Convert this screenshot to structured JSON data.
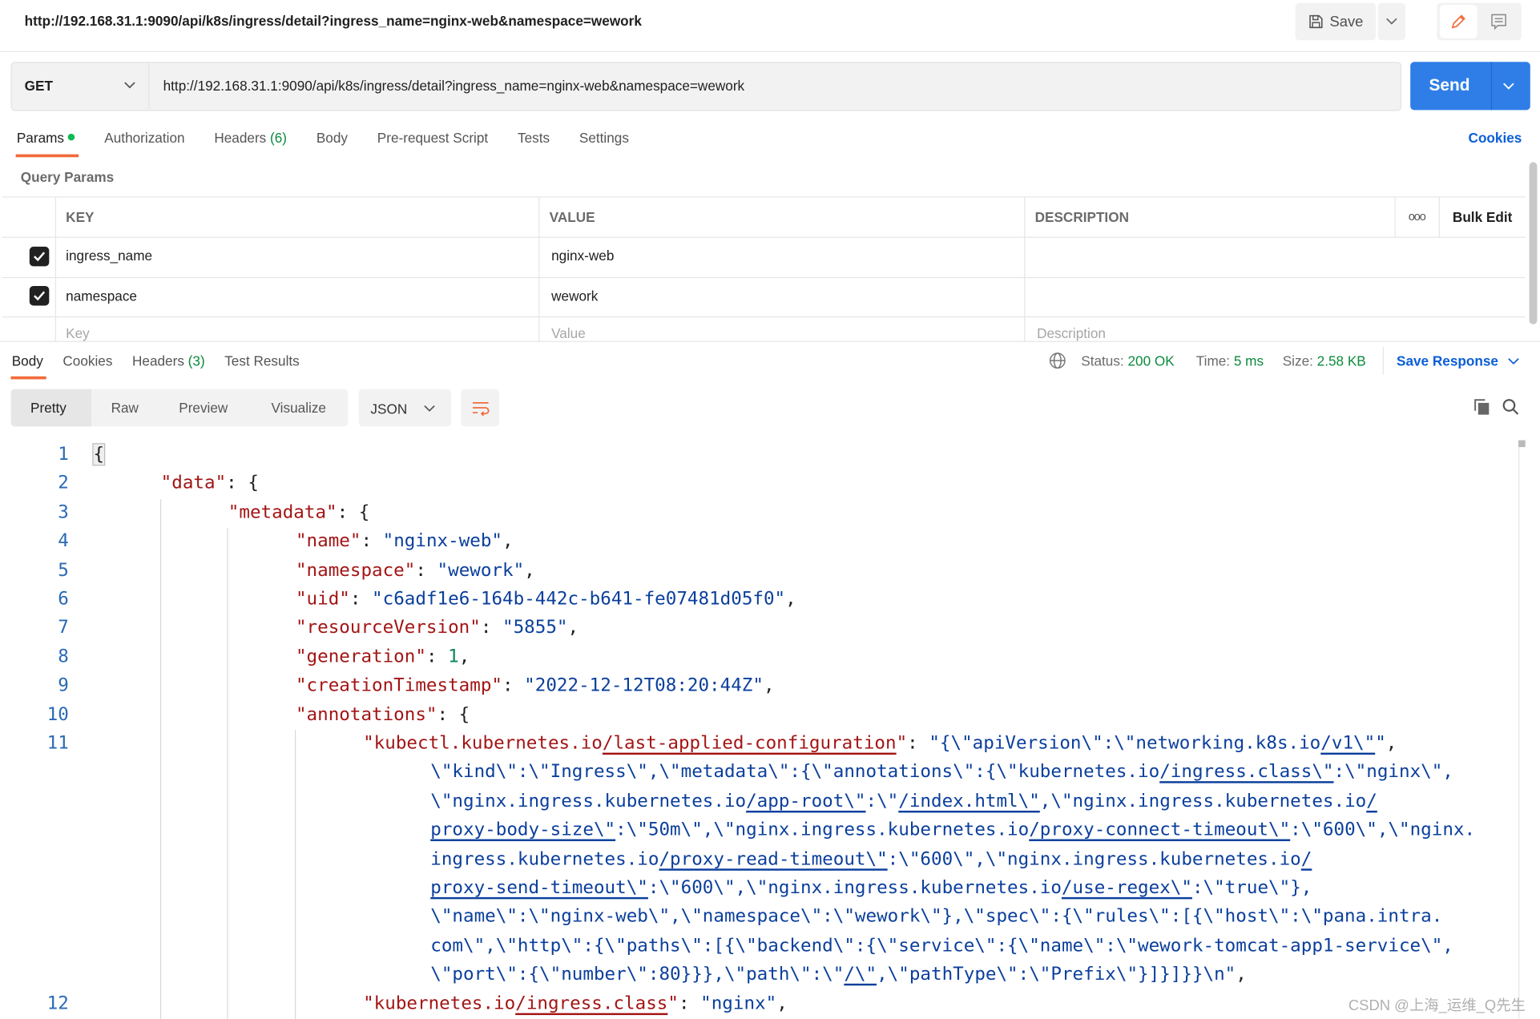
{
  "header": {
    "tab_title": "http://192.168.31.1:9090/api/k8s/ingress/detail?ingress_name=nginx-web&namespace=wework",
    "save_label": "Save"
  },
  "request": {
    "method": "GET",
    "url": "http://192.168.31.1:9090/api/k8s/ingress/detail?ingress_name=nginx-web&namespace=wework",
    "send_label": "Send",
    "tabs": [
      {
        "label": "Params",
        "active": true
      },
      {
        "label": "Authorization"
      },
      {
        "label": "Headers",
        "count": "(6)"
      },
      {
        "label": "Body"
      },
      {
        "label": "Pre-request Script"
      },
      {
        "label": "Tests"
      },
      {
        "label": "Settings"
      }
    ],
    "cookies_label": "Cookies"
  },
  "params": {
    "section_title": "Query Params",
    "columns": {
      "key": "KEY",
      "value": "VALUE",
      "description": "DESCRIPTION",
      "bulk_edit": "Bulk Edit"
    },
    "rows": [
      {
        "checked": true,
        "key": "ingress_name",
        "value": "nginx-web",
        "description": ""
      },
      {
        "checked": true,
        "key": "namespace",
        "value": "wework",
        "description": ""
      }
    ],
    "placeholders": {
      "key": "Key",
      "value": "Value",
      "description": "Description"
    }
  },
  "response": {
    "tabs": [
      {
        "label": "Body",
        "active": true
      },
      {
        "label": "Cookies"
      },
      {
        "label": "Headers",
        "count": "(3)"
      },
      {
        "label": "Test Results"
      }
    ],
    "status_label": "Status:",
    "status": "200 OK",
    "time_label": "Time:",
    "time": "5 ms",
    "size_label": "Size:",
    "size": "2.58 KB",
    "save_response_label": "Save Response",
    "formats": [
      "Pretty",
      "Raw",
      "Preview",
      "Visualize"
    ],
    "active_format": "Pretty",
    "language": "JSON"
  },
  "code_rows": [
    {
      "num": "1",
      "indent": 0,
      "tokens": [
        [
          "p",
          "{"
        ]
      ]
    },
    {
      "num": "2",
      "indent": 1,
      "tokens": [
        [
          "k",
          "\"data\""
        ],
        [
          "p",
          ": {"
        ]
      ]
    },
    {
      "num": "3",
      "indent": 2,
      "tokens": [
        [
          "k",
          "\"metadata\""
        ],
        [
          "p",
          ": {"
        ]
      ]
    },
    {
      "num": "4",
      "indent": 3,
      "tokens": [
        [
          "k",
          "\"name\""
        ],
        [
          "p",
          ": "
        ],
        [
          "s",
          "\"nginx-web\""
        ],
        [
          "p",
          ","
        ]
      ]
    },
    {
      "num": "5",
      "indent": 3,
      "tokens": [
        [
          "k",
          "\"namespace\""
        ],
        [
          "p",
          ": "
        ],
        [
          "s",
          "\"wework\""
        ],
        [
          "p",
          ","
        ]
      ]
    },
    {
      "num": "6",
      "indent": 3,
      "tokens": [
        [
          "k",
          "\"uid\""
        ],
        [
          "p",
          ": "
        ],
        [
          "s",
          "\"c6adf1e6-164b-442c-b641-fe07481d05f0\""
        ],
        [
          "p",
          ","
        ]
      ]
    },
    {
      "num": "7",
      "indent": 3,
      "tokens": [
        [
          "k",
          "\"resourceVersion\""
        ],
        [
          "p",
          ": "
        ],
        [
          "s",
          "\"5855\""
        ],
        [
          "p",
          ","
        ]
      ]
    },
    {
      "num": "8",
      "indent": 3,
      "tokens": [
        [
          "k",
          "\"generation\""
        ],
        [
          "p",
          ": "
        ],
        [
          "n",
          "1"
        ],
        [
          "p",
          ","
        ]
      ]
    },
    {
      "num": "9",
      "indent": 3,
      "tokens": [
        [
          "k",
          "\"creationTimestamp\""
        ],
        [
          "p",
          ": "
        ],
        [
          "s",
          "\"2022-12-12T08:20:44Z\""
        ],
        [
          "p",
          ","
        ]
      ]
    },
    {
      "num": "10",
      "indent": 3,
      "tokens": [
        [
          "k",
          "\"annotations\""
        ],
        [
          "p",
          ": {"
        ]
      ]
    },
    {
      "num": "11",
      "indent": 4,
      "tokens": [
        [
          "k",
          "\"kubectl.kubernetes.io"
        ],
        [
          "ku",
          "/last-applied-configuration"
        ],
        [
          "k",
          "\""
        ],
        [
          "p",
          ": "
        ],
        [
          "s",
          "\"{\\\"apiVersion\\\":\\\"networking.k8s.io"
        ],
        [
          "su",
          "/v1\\\""
        ],
        [
          "s",
          "\""
        ],
        [
          "p",
          ","
        ]
      ]
    },
    {
      "num": "",
      "indent": 5,
      "tokens": [
        [
          "s",
          "\\\"kind\\\":\\\"Ingress\\\",\\\"metadata\\\":{\\\"annotations\\\":{\\\"kubernetes.io"
        ],
        [
          "su",
          "/ingress.class\\\""
        ],
        [
          "s",
          ":\\\"nginx\\\","
        ]
      ]
    },
    {
      "num": "",
      "indent": 5,
      "tokens": [
        [
          "s",
          "\\\"nginx.ingress.kubernetes.io"
        ],
        [
          "su",
          "/app-root\\\""
        ],
        [
          "s",
          ":\\\""
        ],
        [
          "su",
          "/index.html\\\""
        ],
        [
          "s",
          ",\\\"nginx.ingress.kubernetes.io"
        ],
        [
          "su",
          "/"
        ]
      ]
    },
    {
      "num": "",
      "indent": 5,
      "tokens": [
        [
          "su",
          "proxy-body-size\\\""
        ],
        [
          "s",
          ":\\\"50m\\\",\\\"nginx.ingress.kubernetes.io"
        ],
        [
          "su",
          "/proxy-connect-timeout\\\""
        ],
        [
          "s",
          ":\\\"600\\\",\\\"nginx."
        ]
      ]
    },
    {
      "num": "",
      "indent": 5,
      "tokens": [
        [
          "s",
          "ingress.kubernetes.io"
        ],
        [
          "su",
          "/proxy-read-timeout\\\""
        ],
        [
          "s",
          ":\\\"600\\\",\\\"nginx.ingress.kubernetes.io"
        ],
        [
          "su",
          "/"
        ]
      ]
    },
    {
      "num": "",
      "indent": 5,
      "tokens": [
        [
          "su",
          "proxy-send-timeout\\\""
        ],
        [
          "s",
          ":\\\"600\\\",\\\"nginx.ingress.kubernetes.io"
        ],
        [
          "su",
          "/use-regex\\\""
        ],
        [
          "s",
          ":\\\"true\\\"},"
        ]
      ]
    },
    {
      "num": "",
      "indent": 5,
      "tokens": [
        [
          "s",
          "\\\"name\\\":\\\"nginx-web\\\",\\\"namespace\\\":\\\"wework\\\"},\\\"spec\\\":{\\\"rules\\\":[{\\\"host\\\":\\\"pana.intra."
        ]
      ]
    },
    {
      "num": "",
      "indent": 5,
      "tokens": [
        [
          "s",
          "com\\\",\\\"http\\\":{\\\"paths\\\":[{\\\"backend\\\":{\\\"service\\\":{\\\"name\\\":\\\"wework-tomcat-app1-service\\\","
        ]
      ]
    },
    {
      "num": "",
      "indent": 5,
      "tokens": [
        [
          "s",
          "\\\"port\\\":{\\\"number\\\":80}}},\\\"path\\\":\\\""
        ],
        [
          "su",
          "/\\\""
        ],
        [
          "s",
          ",\\\"pathType\\\":\\\"Prefix\\\"}]}]}}\\n\""
        ],
        [
          "p",
          ","
        ]
      ]
    },
    {
      "num": "12",
      "indent": 4,
      "tokens": [
        [
          "k",
          "\"kubernetes.io"
        ],
        [
          "ku",
          "/ingress.class"
        ],
        [
          "k",
          "\""
        ],
        [
          "p",
          ": "
        ],
        [
          "s",
          "\"nginx\""
        ],
        [
          "p",
          ","
        ]
      ]
    }
  ],
  "watermark": "CSDN @上海_运维_Q先生",
  "colors": {
    "accent": "#f26b3a",
    "send": "#2f7ee8",
    "link": "#0b5ed7",
    "status_ok": "#0c8a3e",
    "json_key": "#a31515",
    "json_string": "#0b3f9c",
    "json_number": "#098658"
  }
}
